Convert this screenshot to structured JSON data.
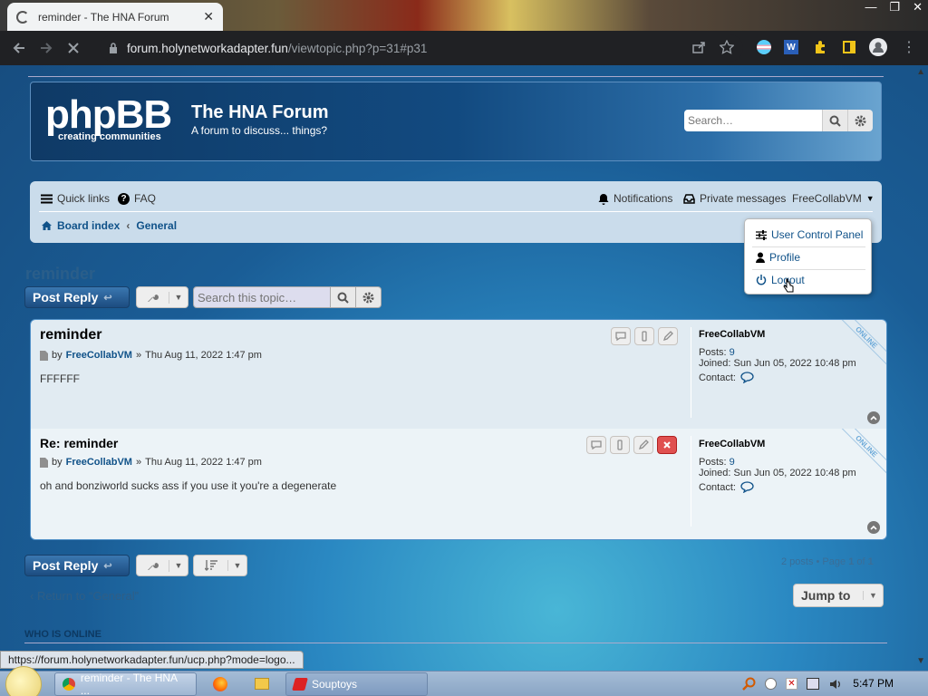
{
  "browser": {
    "tab_title": "reminder - The HNA Forum",
    "url_host": "forum.holynetworkadapter.fun",
    "url_path": "/viewtopic.php?p=31#p31"
  },
  "header": {
    "logo_text": "phpBB",
    "logo_sub": "creating communities",
    "site_title": "The HNA Forum",
    "site_desc": "A forum to discuss... things?",
    "search_placeholder": "Search…"
  },
  "navbar": {
    "quick_links": "Quick links",
    "faq": "FAQ",
    "notifications": "Notifications",
    "private_messages": "Private messages",
    "username": "FreeCollabVM",
    "breadcrumb_root": "Board index",
    "breadcrumb_forum": "General"
  },
  "user_menu": {
    "items": [
      "User Control Panel",
      "Profile",
      "Logout"
    ]
  },
  "topic": {
    "title": "reminder",
    "reply_label": "Post Reply",
    "search_placeholder": "Search this topic…"
  },
  "posts": [
    {
      "subject": "reminder",
      "by_label": "by",
      "author": "FreeCollabVM",
      "sep": "»",
      "date": "Thu Aug 11, 2022 1:47 pm",
      "body": "FFFFFF",
      "profile_name": "FreeCollabVM",
      "posts_label": "Posts:",
      "posts_count": "9",
      "joined_label": "Joined:",
      "joined": "Sun Jun 05, 2022 10:48 pm",
      "contact_label": "Contact:",
      "status": "ONLINE"
    },
    {
      "subject": "Re: reminder",
      "by_label": "by",
      "author": "FreeCollabVM",
      "sep": "»",
      "date": "Thu Aug 11, 2022 1:47 pm",
      "body": "oh and bonziworld sucks ass if you use it you're a degenerate",
      "profile_name": "FreeCollabVM",
      "posts_label": "Posts:",
      "posts_count": "9",
      "joined_label": "Joined:",
      "joined": "Sun Jun 05, 2022 10:48 pm",
      "contact_label": "Contact:",
      "status": "ONLINE"
    }
  ],
  "pagination": {
    "text": "2 posts • Page",
    "page": "1",
    "of": "of",
    "total": "1"
  },
  "footer": {
    "return_text": "‹ Return to “General”",
    "jump_label": "Jump to",
    "who_is_online": "WHO IS ONLINE"
  },
  "statusbar": {
    "url": "https://forum.holynetworkadapter.fun/ucp.php?mode=logo..."
  },
  "taskbar": {
    "items": [
      "reminder - The HNA ...",
      "Souptoys"
    ],
    "clock": "5:47 PM"
  },
  "colors": {
    "link": "#105289",
    "header_bg": "#0f3a66",
    "button_blue": "#1c4c80",
    "delete_red": "#e05050"
  },
  "icons": [
    "hamburger-icon",
    "question-icon",
    "bell-icon",
    "inbox-icon",
    "home-icon",
    "search-icon",
    "gear-icon",
    "wrench-icon",
    "quote-icon",
    "warn-icon",
    "edit-icon",
    "delete-icon",
    "speech-icon",
    "up-arrow-icon",
    "logout-icon",
    "user-icon",
    "sliders-icon"
  ]
}
